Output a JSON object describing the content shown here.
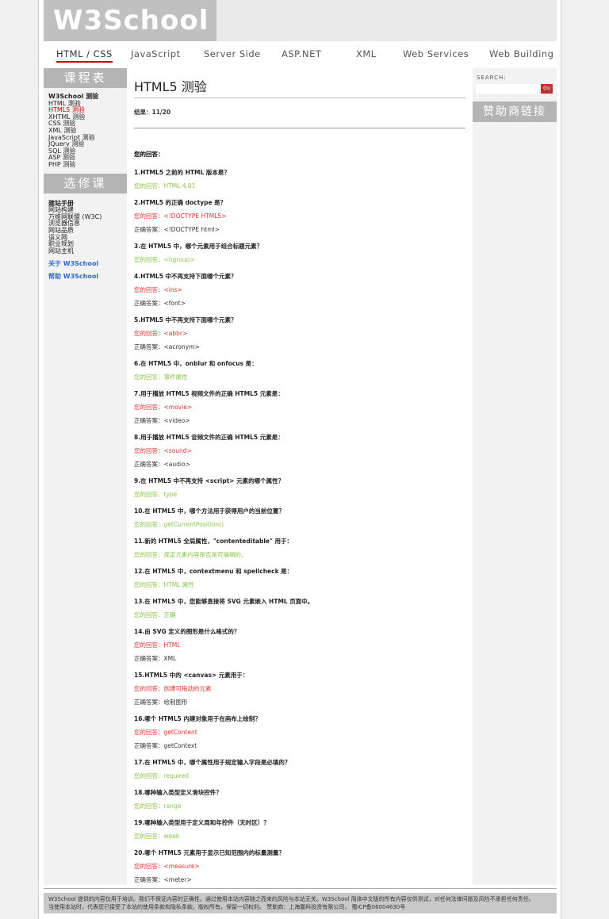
{
  "logo": "W3School",
  "nav": [
    "HTML / CSS",
    "JavaScript",
    "Server Side",
    "ASP.NET",
    "XML",
    "Web Services",
    "Web Building"
  ],
  "left": {
    "section1_title": "课程表",
    "section1_items": [
      "W3School 测验",
      "HTML 测验",
      "HTML5 测验",
      "XHTML 测验",
      "CSS 测验",
      "XML 测验",
      "JavaScript 测验",
      "JQuery 测验",
      "SQL 测验",
      "ASP 测验",
      "PHP 测验"
    ],
    "section2_title": "选修课",
    "section2_items": [
      "建站手册",
      "网站构建",
      "万维网联盟 (W3C)",
      "浏览器信息",
      "网站品质",
      "语义网",
      "职业规划",
      "网站主机"
    ],
    "about": "关于 W3School",
    "help": "帮助 W3School"
  },
  "content": {
    "title": "HTML5 测验",
    "result": "结果：11/20",
    "answers_heading": "您的回答："
  },
  "questions": [
    {
      "q": "1.HTML5 之前的 HTML 版本是？",
      "your": "您的回答：HTML 4.01",
      "status": "ok",
      "correct": ""
    },
    {
      "q": "2.HTML5 的正确 doctype 是？",
      "your": "您的回答：<!DOCTYPE HTML5>",
      "status": "bad",
      "correct": "正确答案：<!DOCTYPE html>"
    },
    {
      "q": "3.在 HTML5 中，哪个元素用于组合标题元素？",
      "your": "您的回答：<hgroup>",
      "status": "ok",
      "correct": ""
    },
    {
      "q": "4.HTML5 中不再支持下面哪个元素？",
      "your": "您的回答：<ins>",
      "status": "bad",
      "correct": "正确答案：<font>"
    },
    {
      "q": "5.HTML5 中不再支持下面哪个元素？",
      "your": "您的回答：<abbr>",
      "status": "bad",
      "correct": "正确答案：<acronym>"
    },
    {
      "q": "6.在 HTML5 中，onblur 和 onfocus 是：",
      "your": "您的回答：事件属性",
      "status": "ok",
      "correct": ""
    },
    {
      "q": "7.用于播放 HTML5 视频文件的正确 HTML5 元素是：",
      "your": "您的回答：<movie>",
      "status": "bad",
      "correct": "正确答案：<video>"
    },
    {
      "q": "8.用于播放 HTML5 音频文件的正确 HTML5 元素是：",
      "your": "您的回答：<sound>",
      "status": "bad",
      "correct": "正确答案：<audio>"
    },
    {
      "q": "9.在 HTML5 中不再支持 <script> 元素的哪个属性？",
      "your": "您的回答：type",
      "status": "ok",
      "correct": ""
    },
    {
      "q": "10.在 HTML5 中，哪个方法用于获得用户的当前位置？",
      "your": "您的回答：getCurrentPosition()",
      "status": "ok",
      "correct": ""
    },
    {
      "q": "11.新的 HTML5 全局属性，\"contenteditable\" 用于：",
      "your": "您的回答：规定元素内容是否是可编辑的。",
      "status": "ok",
      "correct": ""
    },
    {
      "q": "12.在 HTML5 中，contextmenu 和 spellcheck 是：",
      "your": "您的回答：HTML 属性",
      "status": "ok",
      "correct": ""
    },
    {
      "q": "13.在 HTML5 中，您能够直接将 SVG 元素嵌入 HTML 页面中。",
      "your": "您的回答：正确",
      "status": "ok",
      "correct": ""
    },
    {
      "q": "14.由 SVG 定义的图形是什么格式的？",
      "your": "您的回答：HTML",
      "status": "bad",
      "correct": "正确答案：XML"
    },
    {
      "q": "15.HTML5 中的 <canvas> 元素用于：",
      "your": "您的回答：创建可拖动的元素",
      "status": "bad",
      "correct": "正确答案：绘制图形"
    },
    {
      "q": "16.哪个 HTML5 内建对象用于在画布上绘制？",
      "your": "您的回答：getContent",
      "status": "bad",
      "correct": "正确答案：getContext"
    },
    {
      "q": "17.在 HTML5 中，哪个属性用于规定输入字段是必填的？",
      "your": "您的回答：required",
      "status": "ok",
      "correct": ""
    },
    {
      "q": "18.哪种输入类型定义滑块控件？",
      "your": "您的回答：range",
      "status": "ok",
      "correct": ""
    },
    {
      "q": "19.哪种输入类型用于定义周和年控件（无时区）？",
      "your": "您的回答：week",
      "status": "ok",
      "correct": ""
    },
    {
      "q": "20.哪个 HTML5 元素用于显示已知范围内的标量测量？",
      "your": "您的回答：<measure>",
      "status": "bad",
      "correct": "正确答案：<meter>"
    }
  ],
  "right": {
    "search_label": "SEARCH:",
    "search_button": "Go",
    "sponsor": "赞助商链接"
  },
  "footer": {
    "line1": "W3School 提供的内容仅用于培训。我们不保证内容的正确性。通过使用本站内容随之而来的风险与本站无关。W3School 简体中文版的所有内容仅供测试，对任何法律问题及风险不承担任何责任。",
    "line2": "当使用本站时，代表您已接受了本站的使用条款和隐私条款。版权所有，保留一切权利。 赞助商：上海赢科投资有限公司， 蜀ICP备06004630号"
  },
  "colors": {
    "correct": "#8bc34a",
    "wrong": "#e03030",
    "accent": "#cc0000",
    "header_gray": "#c0c0c0"
  }
}
